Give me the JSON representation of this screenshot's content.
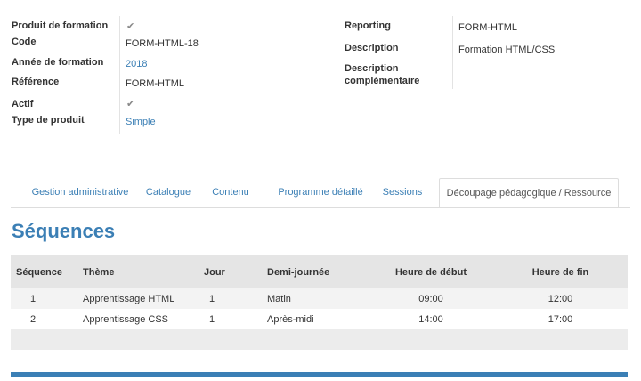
{
  "details_left": {
    "produit_formation_label": "Produit de formation",
    "produit_formation_value": "✔",
    "code_label": "Code",
    "code_value": "FORM-HTML-18",
    "annee_label": "Année de formation",
    "annee_value": "2018",
    "reference_label": "Référence",
    "reference_value": "FORM-HTML",
    "actif_label": "Actif",
    "actif_value": "✔",
    "type_label": "Type de produit",
    "type_value": "Simple"
  },
  "details_right": {
    "reporting_label": "Reporting",
    "reporting_value": "FORM-HTML",
    "description_label": "Description",
    "description_value": "Formation HTML/CSS",
    "description_comp_label_1": "Description",
    "description_comp_label_2": "complémentaire"
  },
  "tabs": [
    {
      "label": "Gestion administrative"
    },
    {
      "label": "Catalogue"
    },
    {
      "label": "Contenu"
    },
    {
      "label": "Programme détaillé"
    },
    {
      "label": "Sessions"
    },
    {
      "label": "Découpage pédagogique / Ressource",
      "active": true
    }
  ],
  "section_title": "Séquences",
  "table": {
    "headers": [
      "Séquence",
      "Thème",
      "Jour",
      "Demi-journée",
      "Heure de début",
      "Heure de fin"
    ],
    "rows": [
      [
        "1",
        "Apprentissage HTML",
        "1",
        "Matin",
        "09:00",
        "12:00"
      ],
      [
        "2",
        "Apprentissage CSS",
        "1",
        "Après-midi",
        "14:00",
        "17:00"
      ]
    ]
  },
  "colors": {
    "accent": "#3b7fb5",
    "header_bg": "#e5e5e5"
  }
}
